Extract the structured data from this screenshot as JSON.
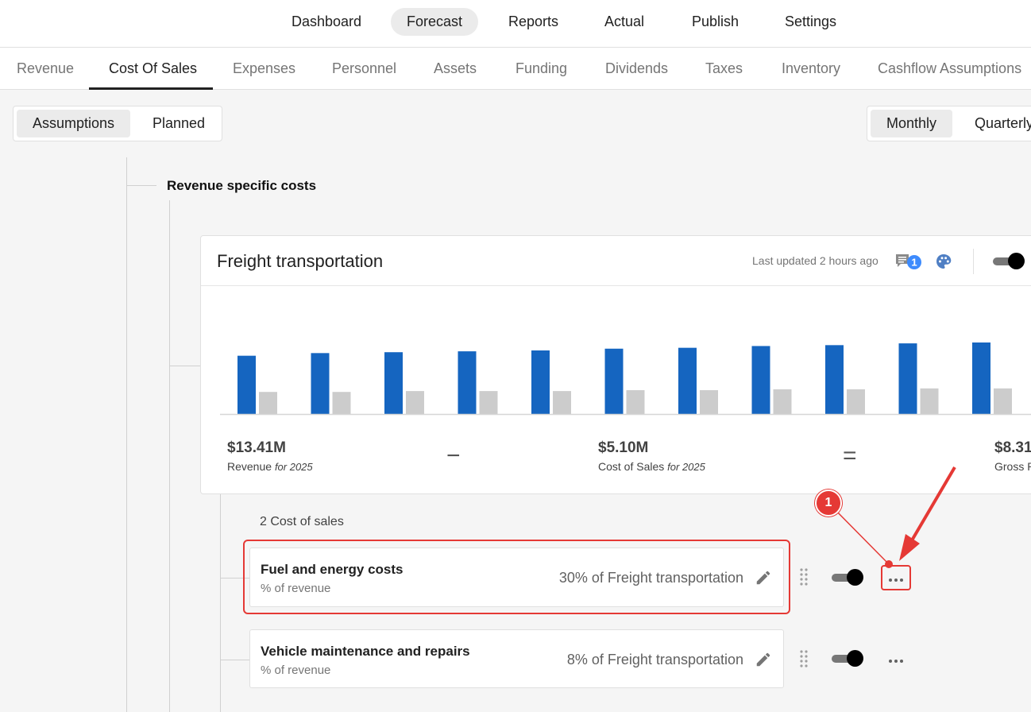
{
  "top_nav": {
    "items": [
      "Dashboard",
      "Forecast",
      "Reports",
      "Actual",
      "Publish",
      "Settings"
    ],
    "active": "Forecast"
  },
  "sub_tabs": {
    "items": [
      "Revenue",
      "Cost Of Sales",
      "Expenses",
      "Personnel",
      "Assets",
      "Funding",
      "Dividends",
      "Taxes",
      "Inventory",
      "Cashflow Assumptions"
    ],
    "active": "Cost Of Sales"
  },
  "view_toggle": {
    "options": [
      "Assumptions",
      "Planned"
    ],
    "active": "Assumptions"
  },
  "period_toggle": {
    "options": [
      "Monthly",
      "Quarterly"
    ],
    "active": "Monthly"
  },
  "section": {
    "title": "Revenue specific costs"
  },
  "card": {
    "title": "Freight transportation",
    "last_updated": "Last updated 2 hours ago",
    "comment_count": "1",
    "enabled": true,
    "summary": {
      "revenue_value": "$13.41M",
      "revenue_label": "Revenue",
      "revenue_year": "for 2025",
      "minus": "−",
      "cos_value": "$5.10M",
      "cos_label": "Cost of Sales",
      "cos_year": "for 2025",
      "equals": "=",
      "gp_value": "$8.31",
      "gp_label": "Gross P"
    }
  },
  "chart_data": {
    "type": "bar",
    "categories": [
      "",
      "",
      "",
      "",
      "",
      "",
      "",
      "",
      "",
      "",
      ""
    ],
    "series": [
      {
        "values": [
          66,
          69,
          70,
          71,
          72,
          74,
          75,
          77,
          78,
          80,
          81
        ]
      },
      {
        "values": [
          25,
          25,
          26,
          26,
          26,
          27,
          27,
          28,
          28,
          29,
          29
        ]
      }
    ],
    "ylim": [
      0,
      90
    ],
    "colors": [
      "#1565c0",
      "#cccccc"
    ],
    "grid": false
  },
  "costs": {
    "count_label": "2 Cost of sales",
    "items": [
      {
        "name": "Fuel and energy costs",
        "type": "% of revenue",
        "value": "30% of Freight transportation",
        "enabled": true
      },
      {
        "name": "Vehicle maintenance and repairs",
        "type": "% of revenue",
        "value": "8% of Freight transportation",
        "enabled": true
      }
    ]
  },
  "annotation": {
    "step": "1",
    "color": "#e53935"
  },
  "colors": {
    "accent_blue": "#1565c0",
    "bar_gray": "#cccccc",
    "annotation_red": "#e53935"
  }
}
